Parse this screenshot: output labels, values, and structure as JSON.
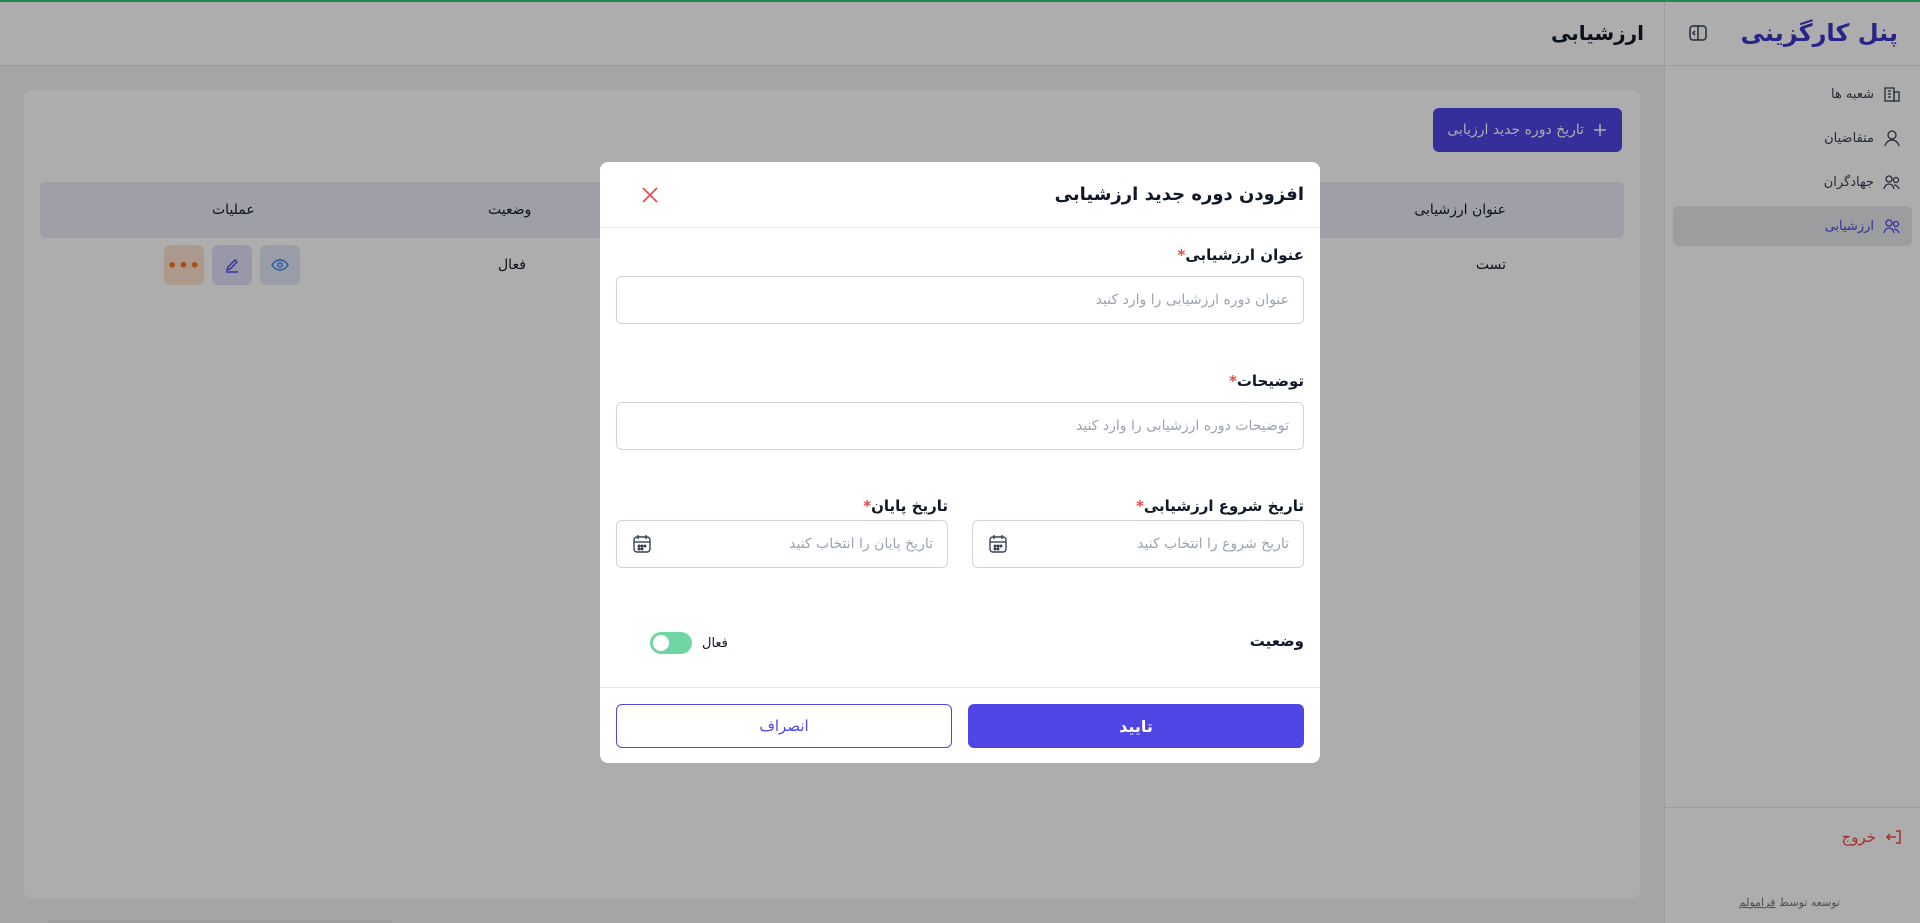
{
  "sidebar": {
    "brand": "پنل کارگزینی",
    "items": [
      {
        "label": "شعبه ها",
        "icon": "building-icon"
      },
      {
        "label": "متقاضیان",
        "icon": "user-icon"
      },
      {
        "label": "جهادگران",
        "icon": "users-icon"
      },
      {
        "label": "ارزشیابی",
        "icon": "users-icon"
      }
    ],
    "logout": "خروج",
    "credit_prefix": "توسعه توسط",
    "credit_link": "فرامولم"
  },
  "header": {
    "title": "ارزشیابی"
  },
  "content": {
    "add_button": "تاریخ دوره جدید ارزیابی",
    "columns": [
      "عنوان ارزشیابی",
      "وضعیت",
      "عملیات"
    ],
    "rows": [
      {
        "title": "تست",
        "status": "فعال"
      }
    ]
  },
  "modal": {
    "title": "افزودن دوره جدید ارزشیابی",
    "title_label": "عنوان ارزشیابی",
    "title_placeholder": "عنوان دوره ارزشیابی را وارد کنید",
    "desc_label": "توضیحات",
    "desc_placeholder": "توضیحات دوره ارزشیابی را وارد کنید",
    "start_label": "تاریخ شروع ارزشیابی",
    "start_placeholder": "تاریخ شروع را انتخاب کنید",
    "end_label": "تاریخ پایان",
    "end_placeholder": "تاریخ پایان را انتخاب کنید",
    "status_label": "وضعیت",
    "toggle_label": "فعال",
    "confirm": "تایید",
    "cancel": "انصراف",
    "required_mark": "*"
  },
  "colors": {
    "accent": "#4f46e5",
    "danger": "#ef4444",
    "toggle": "#6fd6a3",
    "brand": "#3b35c9"
  }
}
